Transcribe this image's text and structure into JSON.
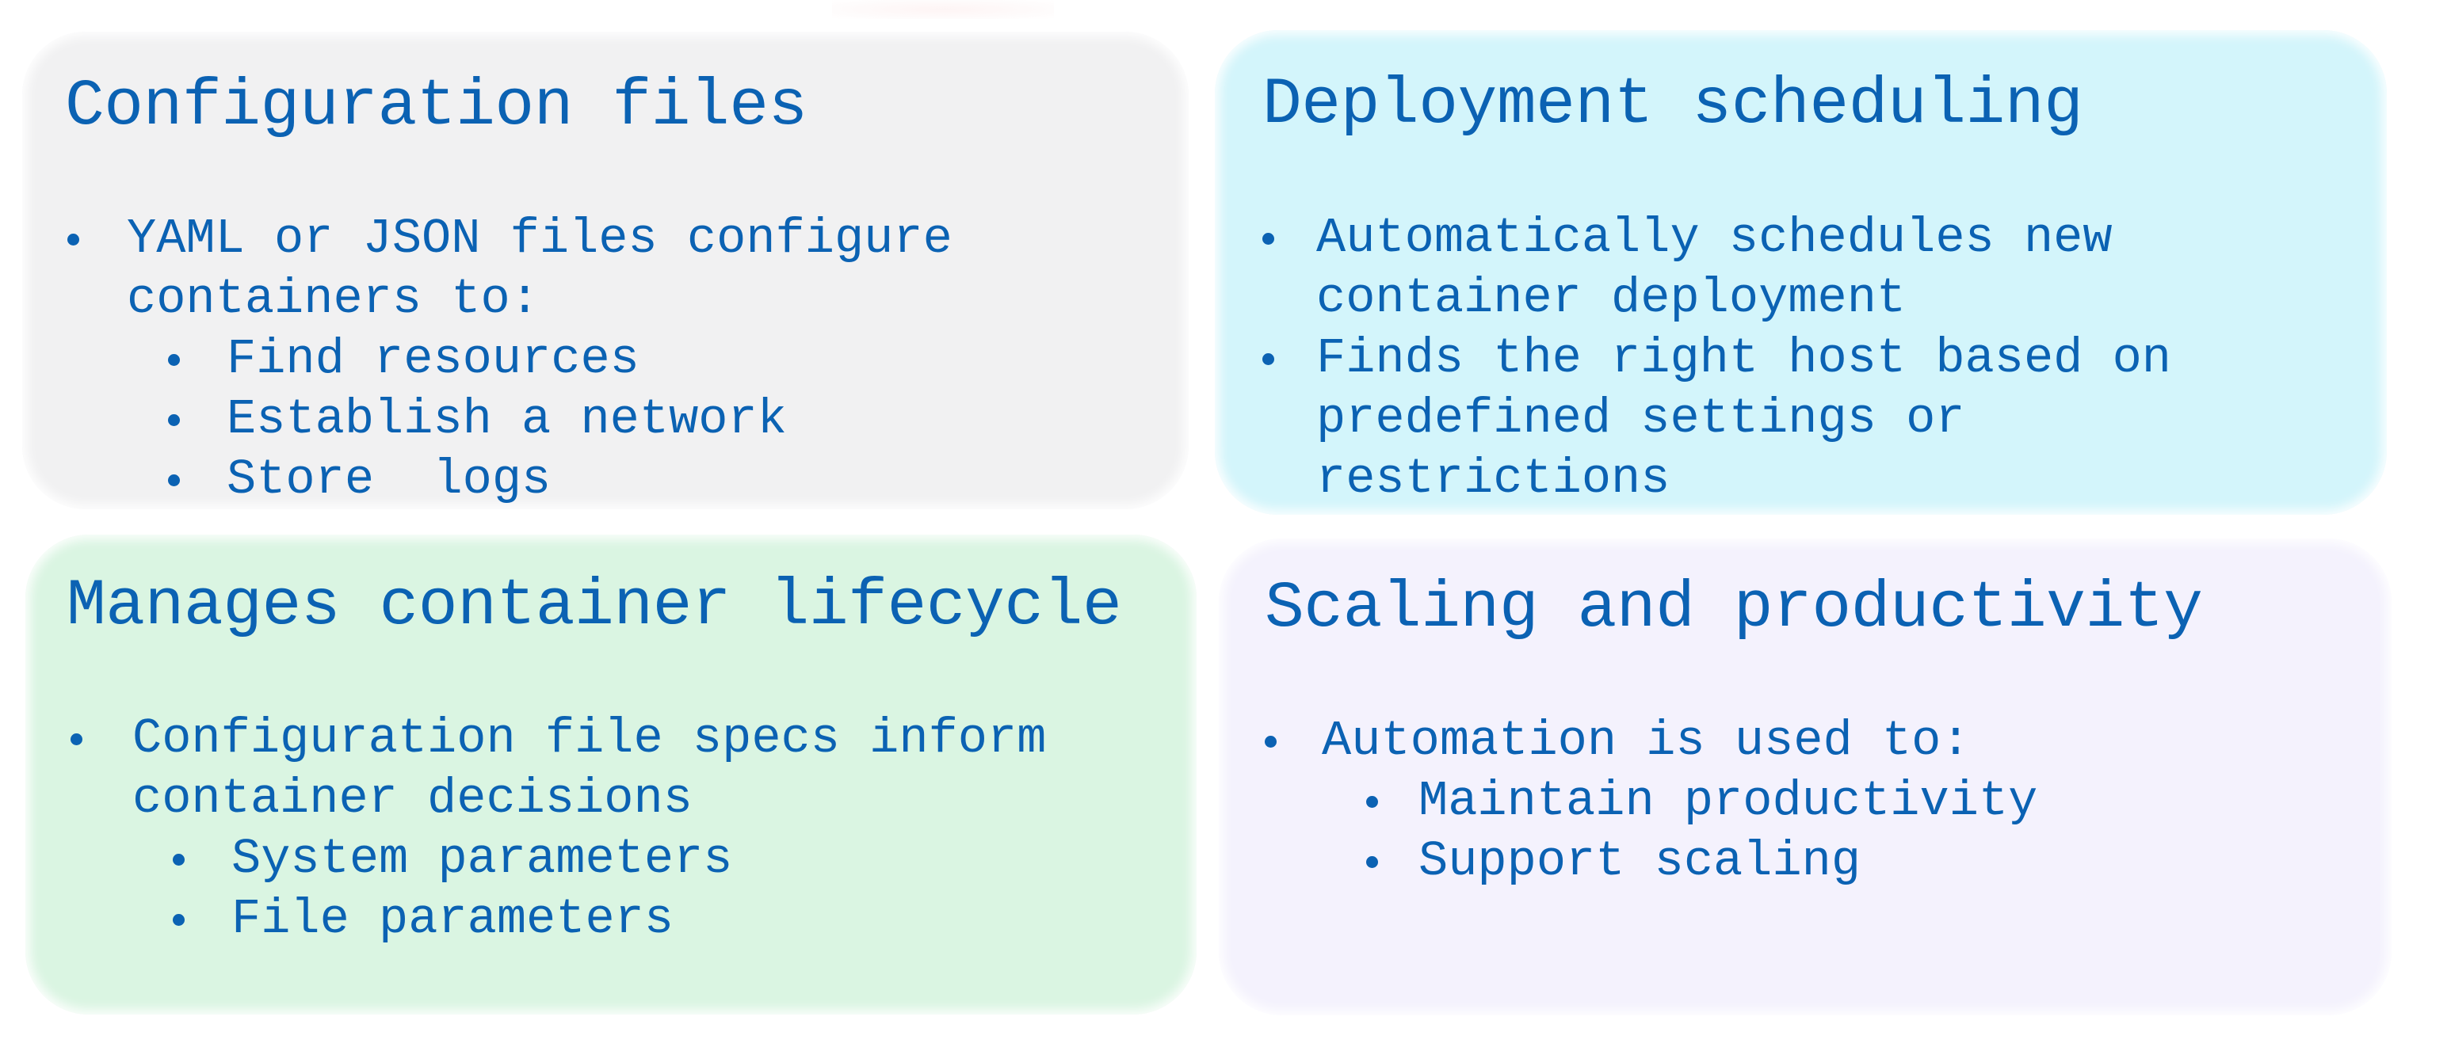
{
  "slide": {
    "cards": [
      {
        "id": "configuration-files",
        "title": "Configuration files",
        "background": "#f1f1f2",
        "bullets": [
          {
            "lines": [
              "YAML or JSON files configure",
              "containers to:"
            ],
            "sub": [
              "Find resources",
              "Establish a network",
              "Store  logs"
            ]
          }
        ]
      },
      {
        "id": "deployment-scheduling",
        "title": "Deployment scheduling",
        "background": "#d3f5fb",
        "bullets": [
          {
            "lines": [
              "Automatically schedules new",
              "container deployment"
            ],
            "sub": []
          },
          {
            "lines": [
              "Finds the right host based on",
              "predefined settings or",
              "restrictions"
            ],
            "sub": []
          }
        ]
      },
      {
        "id": "manages-container-lifecycle",
        "title": "Manages container lifecycle",
        "background": "#daf5e2",
        "bullets": [
          {
            "lines": [
              "Configuration file specs inform",
              "container decisions"
            ],
            "sub": [
              "System parameters",
              "File parameters"
            ]
          }
        ]
      },
      {
        "id": "scaling-and-productivity",
        "title": "Scaling and productivity",
        "background": "#f4f2fd",
        "bullets": [
          {
            "lines": [
              "Automation is used to:"
            ],
            "sub": [
              "Maintain productivity",
              "Support scaling"
            ]
          }
        ]
      }
    ],
    "colors": {
      "text": "#0b62b3",
      "page_background": "#ffffff"
    }
  }
}
